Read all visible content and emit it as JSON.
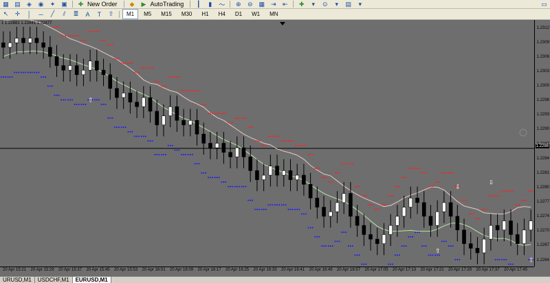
{
  "toolbar": {
    "new_order_label": "New Order",
    "autotrading_label": "AutoTrading"
  },
  "timeframes": [
    "M1",
    "M5",
    "M15",
    "M30",
    "H1",
    "H4",
    "D1",
    "W1",
    "MN"
  ],
  "active_timeframe": "M1",
  "chart": {
    "info": "1 1.22881 1.22841 1.22877",
    "current_price": "1.2288",
    "price_min": 1.2261,
    "price_max": 1.2315,
    "price_labels": [
      "1.2312",
      "1.2309",
      "1.2306",
      "1.2303",
      "1.2300",
      "1.2296",
      "1.2293",
      "1.2290",
      "1.2287",
      "1.2284",
      "1.2281",
      "1.2280",
      "1.2277",
      "1.2274",
      "1.2270",
      "1.2267",
      "1.2264"
    ],
    "time_labels": [
      "20 Apr 15:21",
      "20 Apr 15:29",
      "20 Apr 15:37",
      "20 Apr 15:45",
      "20 Apr 15:53",
      "20 Apr 16:01",
      "20 Apr 16:09",
      "20 Apr 16:17",
      "20 Apr 16:25",
      "20 Apr 16:33",
      "20 Apr 16:41",
      "20 Apr 16:49",
      "20 Apr 16:57",
      "20 Apr 17:05",
      "20 Apr 17:13",
      "20 Apr 17:21",
      "20 Apr 17:29",
      "20 Apr 17:37",
      "20 Apr 17:45"
    ],
    "colors": {
      "background": "#6e6e6e",
      "bull": "#ffffff",
      "bear": "#000000",
      "upper_dots": "#ff2020",
      "lower_dots": "#1a1aff",
      "pink_ma": "#f0c8c8",
      "green_ma": "#b8e6a8"
    }
  },
  "tabs": [
    "URUSD,M1",
    "USDCHF,M1",
    "EURUSD,M1"
  ],
  "active_tab": "EURUSD,M1",
  "chart_data": {
    "type": "candlestick",
    "symbol": "EURUSD",
    "timeframe": "M1",
    "ylim": [
      1.2261,
      1.2315
    ],
    "close": [
      1.2309,
      1.231,
      1.2311,
      1.231,
      1.2311,
      1.231,
      1.2309,
      1.2307,
      1.2305,
      1.2304,
      1.2305,
      1.2303,
      1.2304,
      1.2306,
      1.2304,
      1.2303,
      1.23,
      1.2298,
      1.2299,
      1.2297,
      1.2296,
      1.2298,
      1.2295,
      1.2292,
      1.2294,
      1.2296,
      1.2293,
      1.2292,
      1.2293,
      1.229,
      1.2288,
      1.2287,
      1.2288,
      1.2286,
      1.2285,
      1.2287,
      1.2285,
      1.2282,
      1.228,
      1.2281,
      1.2283,
      1.2281,
      1.2282,
      1.228,
      1.2281,
      1.2279,
      1.2276,
      1.2274,
      1.2272,
      1.2273,
      1.2275,
      1.2277,
      1.2272,
      1.227,
      1.2268,
      1.2267,
      1.2266,
      1.2268,
      1.227,
      1.2272,
      1.2274,
      1.2276,
      1.2275,
      1.2272,
      1.227,
      1.2273,
      1.2275,
      1.2272,
      1.2269,
      1.2266,
      1.2265,
      1.2264,
      1.2267,
      1.227,
      1.2269,
      1.2271,
      1.2268,
      1.2266,
      1.2269,
      1.2271
    ]
  }
}
